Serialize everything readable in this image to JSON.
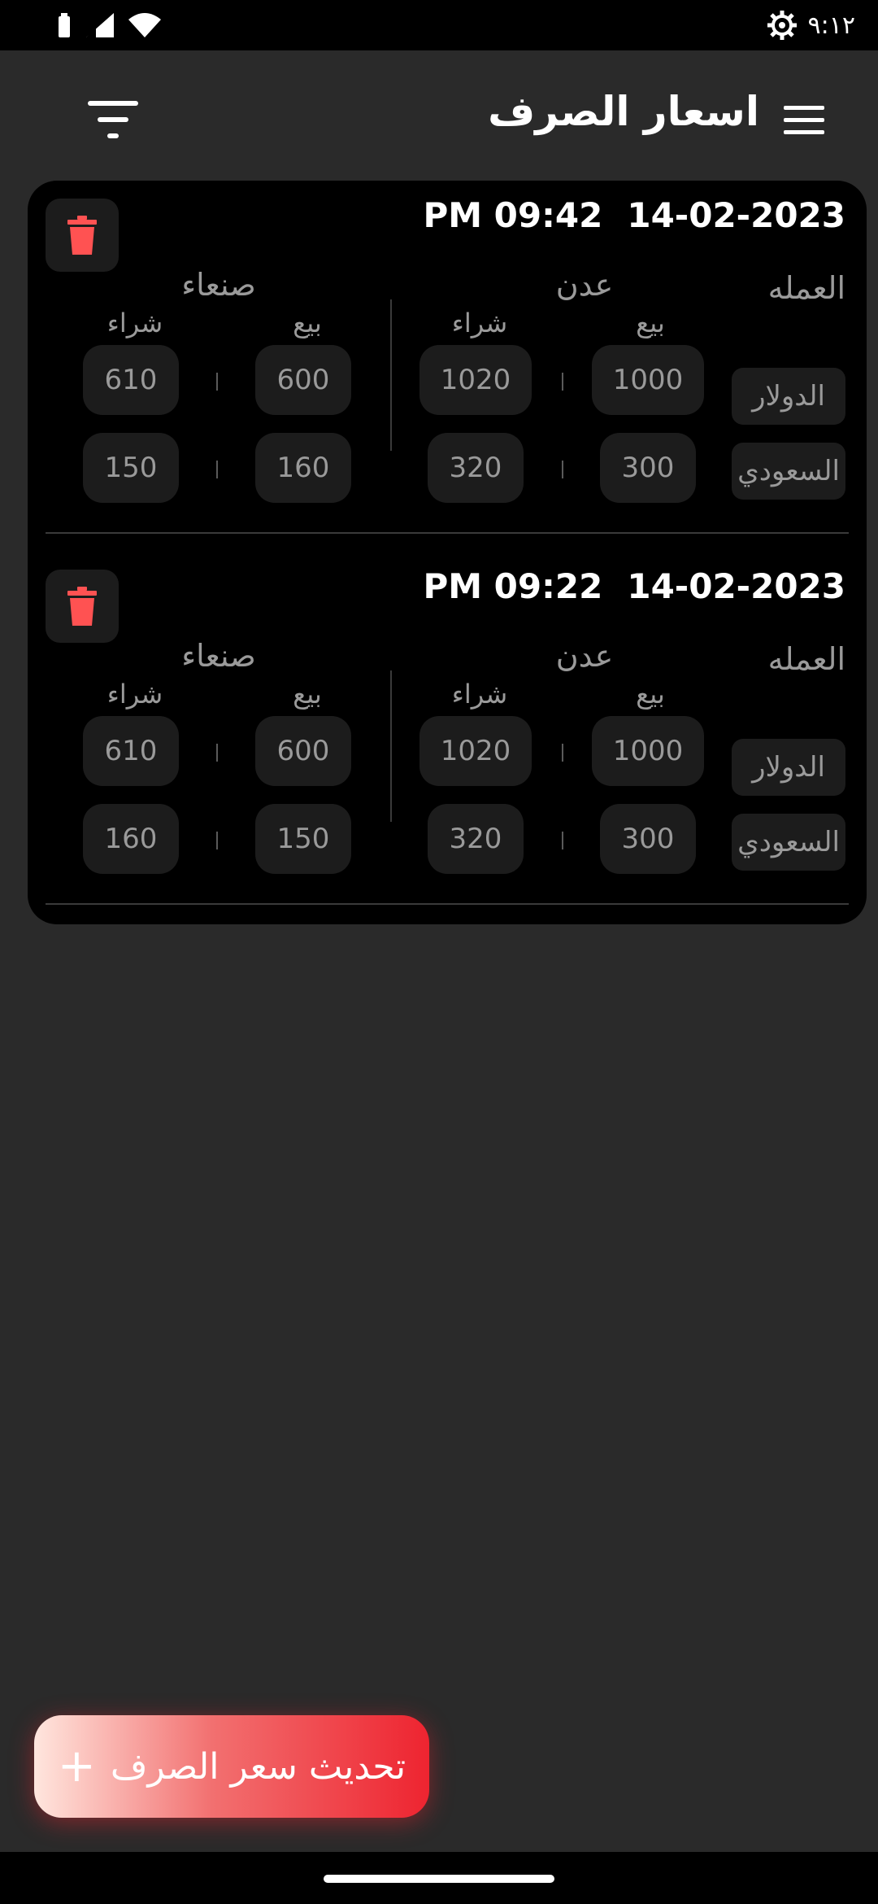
{
  "status_bar": {
    "time": "٩:١٢"
  },
  "header": {
    "title": "اسعار الصرف"
  },
  "labels": {
    "currency_header": "العمله",
    "aden": "عدن",
    "sanaa": "صنعاء",
    "sell": "بيع",
    "buy": "شراء"
  },
  "entries": [
    {
      "date": "14-02-2023",
      "time": "PM 09:42",
      "rows": [
        {
          "currency": "الدولار",
          "aden_sell": "1000",
          "aden_buy": "1020",
          "sanaa_sell": "600",
          "sanaa_buy": "610"
        },
        {
          "currency": "السعودي",
          "aden_sell": "300",
          "aden_buy": "320",
          "sanaa_sell": "160",
          "sanaa_buy": "150"
        }
      ]
    },
    {
      "date": "14-02-2023",
      "time": "PM 09:22",
      "rows": [
        {
          "currency": "الدولار",
          "aden_sell": "1000",
          "aden_buy": "1020",
          "sanaa_sell": "600",
          "sanaa_buy": "610"
        },
        {
          "currency": "السعودي",
          "aden_sell": "300",
          "aden_buy": "320",
          "sanaa_sell": "150",
          "sanaa_buy": "160"
        }
      ]
    }
  ],
  "fab": {
    "label": "تحديث سعر الصرف",
    "icon": "plus-icon"
  },
  "colors": {
    "background": "#2a2a2a",
    "card": "#000000",
    "delete": "#ff5252",
    "fab_end": "#ee2430"
  }
}
